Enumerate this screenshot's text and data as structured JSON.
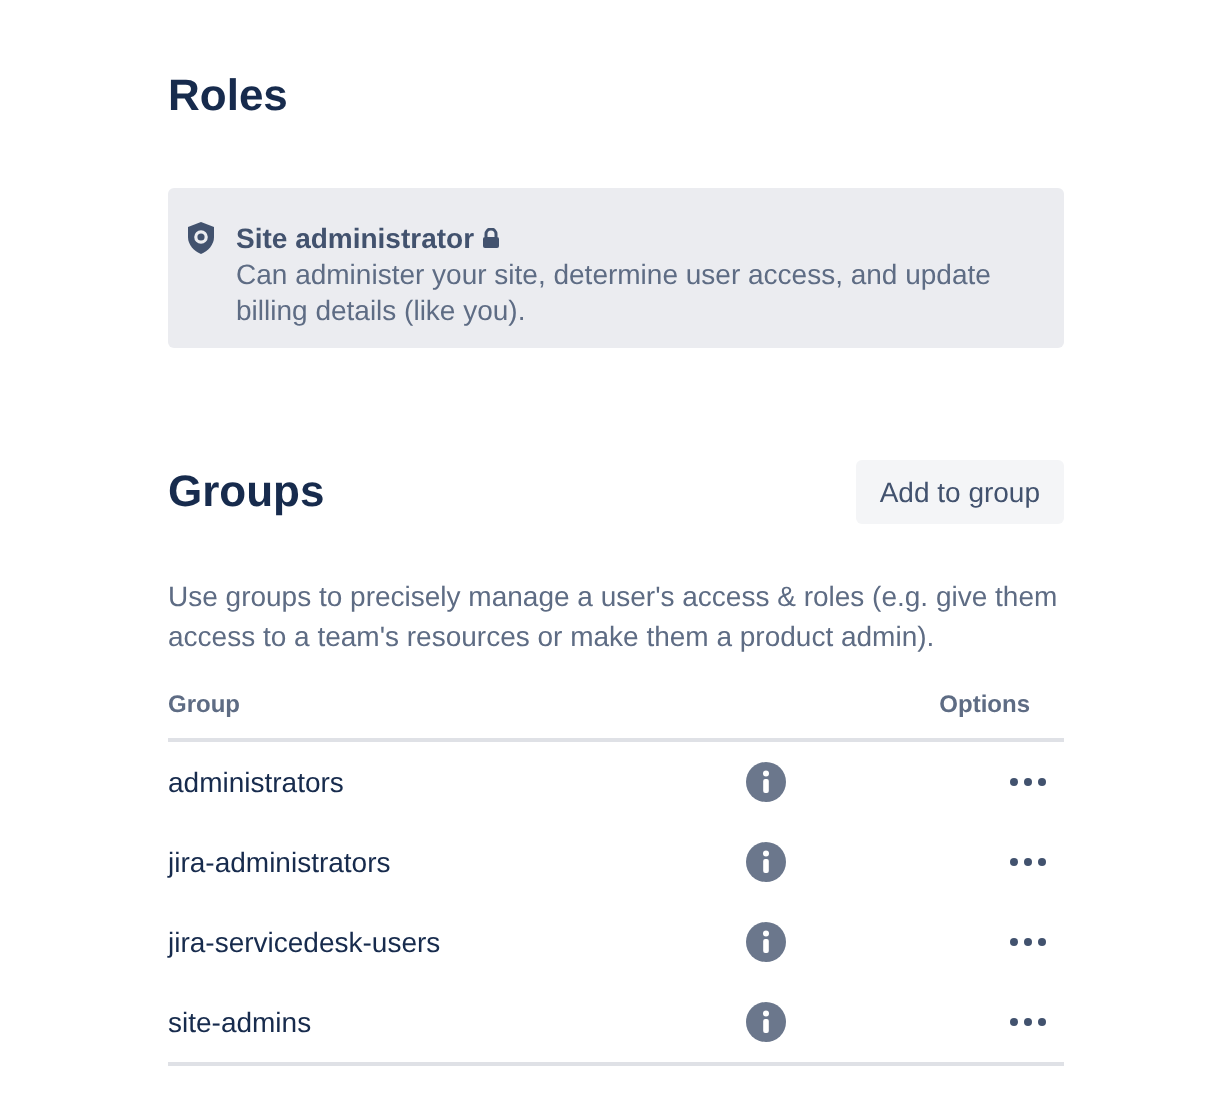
{
  "roles": {
    "title": "Roles",
    "items": [
      {
        "name": "Site administrator",
        "locked": true,
        "description": "Can administer your site, determine user access, and update billing details (like you)."
      }
    ]
  },
  "groups": {
    "title": "Groups",
    "add_button": "Add to group",
    "description": "Use groups to precisely manage a user's access & roles (e.g. give them access to a team's resources or make them a product admin).",
    "columns": [
      "Group",
      "Options"
    ],
    "rows": [
      {
        "name": "administrators"
      },
      {
        "name": "jira-administrators"
      },
      {
        "name": "jira-servicedesk-users"
      },
      {
        "name": "site-admins"
      }
    ]
  }
}
